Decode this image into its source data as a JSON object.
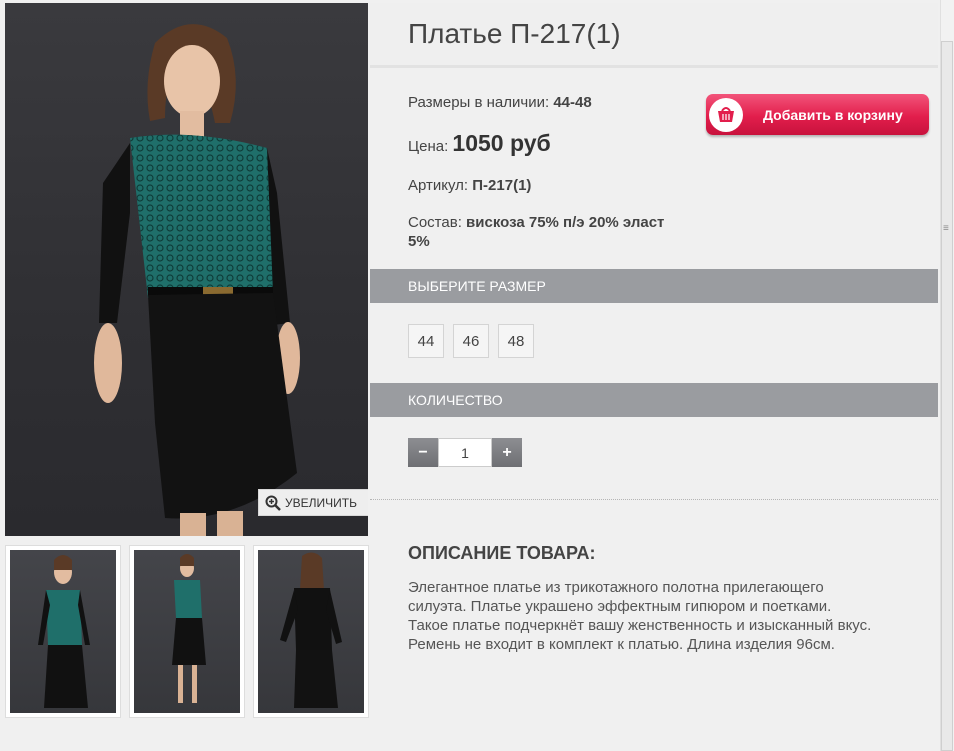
{
  "product": {
    "title": "Платье П-217(1)",
    "sizes_label": "Размеры в наличии:",
    "sizes_value": "44-48",
    "price_label": "Цена:",
    "price_value": "1050 руб",
    "article_label": "Артикул:",
    "article_value": "П-217(1)",
    "composition_label": "Состав:",
    "composition_value_line1": "вискоза 75% п/э 20% эласт",
    "composition_value_line2": "5%"
  },
  "cart_button": {
    "label": "Добавить в корзину",
    "icon": "basket-icon",
    "color": "#e21e4c"
  },
  "gallery": {
    "zoom_label": "УВЕЛИЧИТЬ",
    "zoom_icon": "magnifier-plus-icon",
    "thumbnails": [
      {
        "view": "front"
      },
      {
        "view": "front-full"
      },
      {
        "view": "back"
      }
    ]
  },
  "size_section": {
    "heading": "ВЫБЕРИТЕ РАЗМЕР",
    "options": [
      "44",
      "46",
      "48"
    ]
  },
  "quantity_section": {
    "heading": "КОЛИЧЕСТВО",
    "minus": "−",
    "value": "1",
    "plus": "+"
  },
  "description": {
    "heading": "ОПИСАНИЕ ТОВАРА:",
    "lines": [
      "Элегантное платье из трикотажного полотна прилегающего",
      "силуэта. Платье украшено эффектным гипюром и поетками.",
      "Такое платье подчеркнёт вашу женственность и изысканный вкус.",
      "Ремень не входит в комплект к платью. Длина изделия 96см."
    ]
  },
  "colors": {
    "header_bar": "#9a9ca0",
    "lace": "#1f6f6a",
    "dress": "#121212"
  }
}
